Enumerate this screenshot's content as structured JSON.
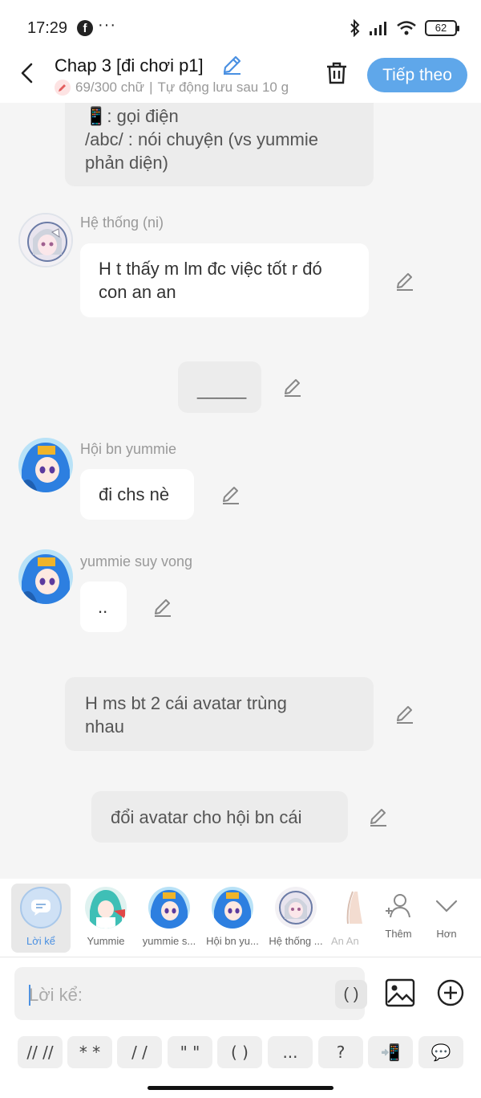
{
  "status": {
    "time": "17:29",
    "battery": "62"
  },
  "header": {
    "title": "Chap 3 [đi chơi p1]",
    "word_count": "69/300 chữ",
    "autosave": "Tự động lưu sau 10 g",
    "next_label": "Tiếp theo"
  },
  "messages": [
    {
      "type": "narration",
      "lines": [
        "📱: gọi điện",
        "/abc/ : nói chuyện (vs yummie",
        "phản diện)"
      ]
    },
    {
      "type": "character",
      "speaker": "Hệ thống (ni)",
      "lines": [
        "H t thấy m lm đc việc tốt r đó",
        "con an an"
      ]
    },
    {
      "type": "narration",
      "lines": [
        "_____"
      ]
    },
    {
      "type": "character",
      "speaker": "Hội bn yummie",
      "lines": [
        "đi chs nè"
      ]
    },
    {
      "type": "character",
      "speaker": "yummie suy vong",
      "lines": [
        ".."
      ]
    },
    {
      "type": "narration",
      "lines": [
        "H ms bt 2 cái avatar trùng",
        "nhau"
      ]
    },
    {
      "type": "narration",
      "lines": [
        "đổi avatar cho hội bn cái"
      ]
    }
  ],
  "character_picker": {
    "items": [
      {
        "label": "Lời kể",
        "selected": true
      },
      {
        "label": "Yummie"
      },
      {
        "label": "yummie s..."
      },
      {
        "label": "Hội bn yu..."
      },
      {
        "label": "Hệ thống ..."
      },
      {
        "label": "An An"
      }
    ],
    "add_label": "Thêm",
    "more_label": "Hơn"
  },
  "input": {
    "placeholder": "Lời kể:",
    "paren_label": "( )"
  },
  "format_toolbar": [
    "// //",
    "* *",
    "/ /",
    "\" \"",
    "( )",
    "...",
    "?",
    "📲",
    "💬"
  ],
  "colors": {
    "accent": "#5fa7ea",
    "narration_bg": "#ececec",
    "chat_bg": "#f5f5f5"
  }
}
